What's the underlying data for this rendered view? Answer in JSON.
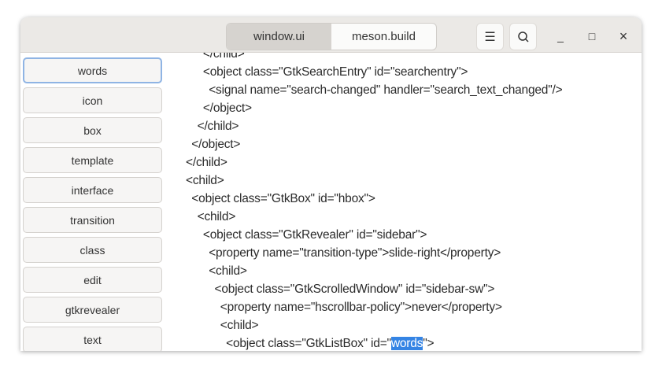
{
  "header": {
    "tabs": [
      "window.ui",
      "meson.build"
    ],
    "active_tab": 0,
    "menu_icon": "hamburger-icon",
    "search_icon": "search-icon",
    "minimize": "_",
    "maximize": "□",
    "close": "×"
  },
  "sidebar": {
    "items": [
      "words",
      "icon",
      "box",
      "template",
      "interface",
      "transition",
      "class",
      "edit",
      "gtkrevealer",
      "text"
    ],
    "focused": 0
  },
  "code": {
    "lines": [
      {
        "indent": 3,
        "text": "</child>"
      },
      {
        "indent": 3,
        "text": "<object class=\"GtkSearchEntry\" id=\"searchentry\">"
      },
      {
        "indent": 4,
        "text": "<signal name=\"search-changed\" handler=\"search_text_changed\"/>"
      },
      {
        "indent": 3,
        "text": "</object>"
      },
      {
        "indent": 2,
        "text": "</child>"
      },
      {
        "indent": 1,
        "text": "</object>"
      },
      {
        "indent": 0,
        "text": "</child>"
      },
      {
        "indent": 0,
        "text": "<child>"
      },
      {
        "indent": 1,
        "text": "<object class=\"GtkBox\" id=\"hbox\">"
      },
      {
        "indent": 2,
        "text": "<child>"
      },
      {
        "indent": 3,
        "text": "<object class=\"GtkRevealer\" id=\"sidebar\">"
      },
      {
        "indent": 4,
        "text": "<property name=\"transition-type\">slide-right</property>"
      },
      {
        "indent": 4,
        "text": "<child>"
      },
      {
        "indent": 5,
        "text": "<object class=\"GtkScrolledWindow\" id=\"sidebar-sw\">"
      },
      {
        "indent": 6,
        "text": "<property name=\"hscrollbar-policy\">never</property>"
      },
      {
        "indent": 6,
        "text": "<child>"
      }
    ],
    "last_line": {
      "indent": 7,
      "before": "<object class=\"GtkListBox\" id=\"",
      "selected": "words",
      "after": "\">"
    }
  },
  "colors": {
    "selection": "#3584e4",
    "header": "#ebe9e6"
  }
}
